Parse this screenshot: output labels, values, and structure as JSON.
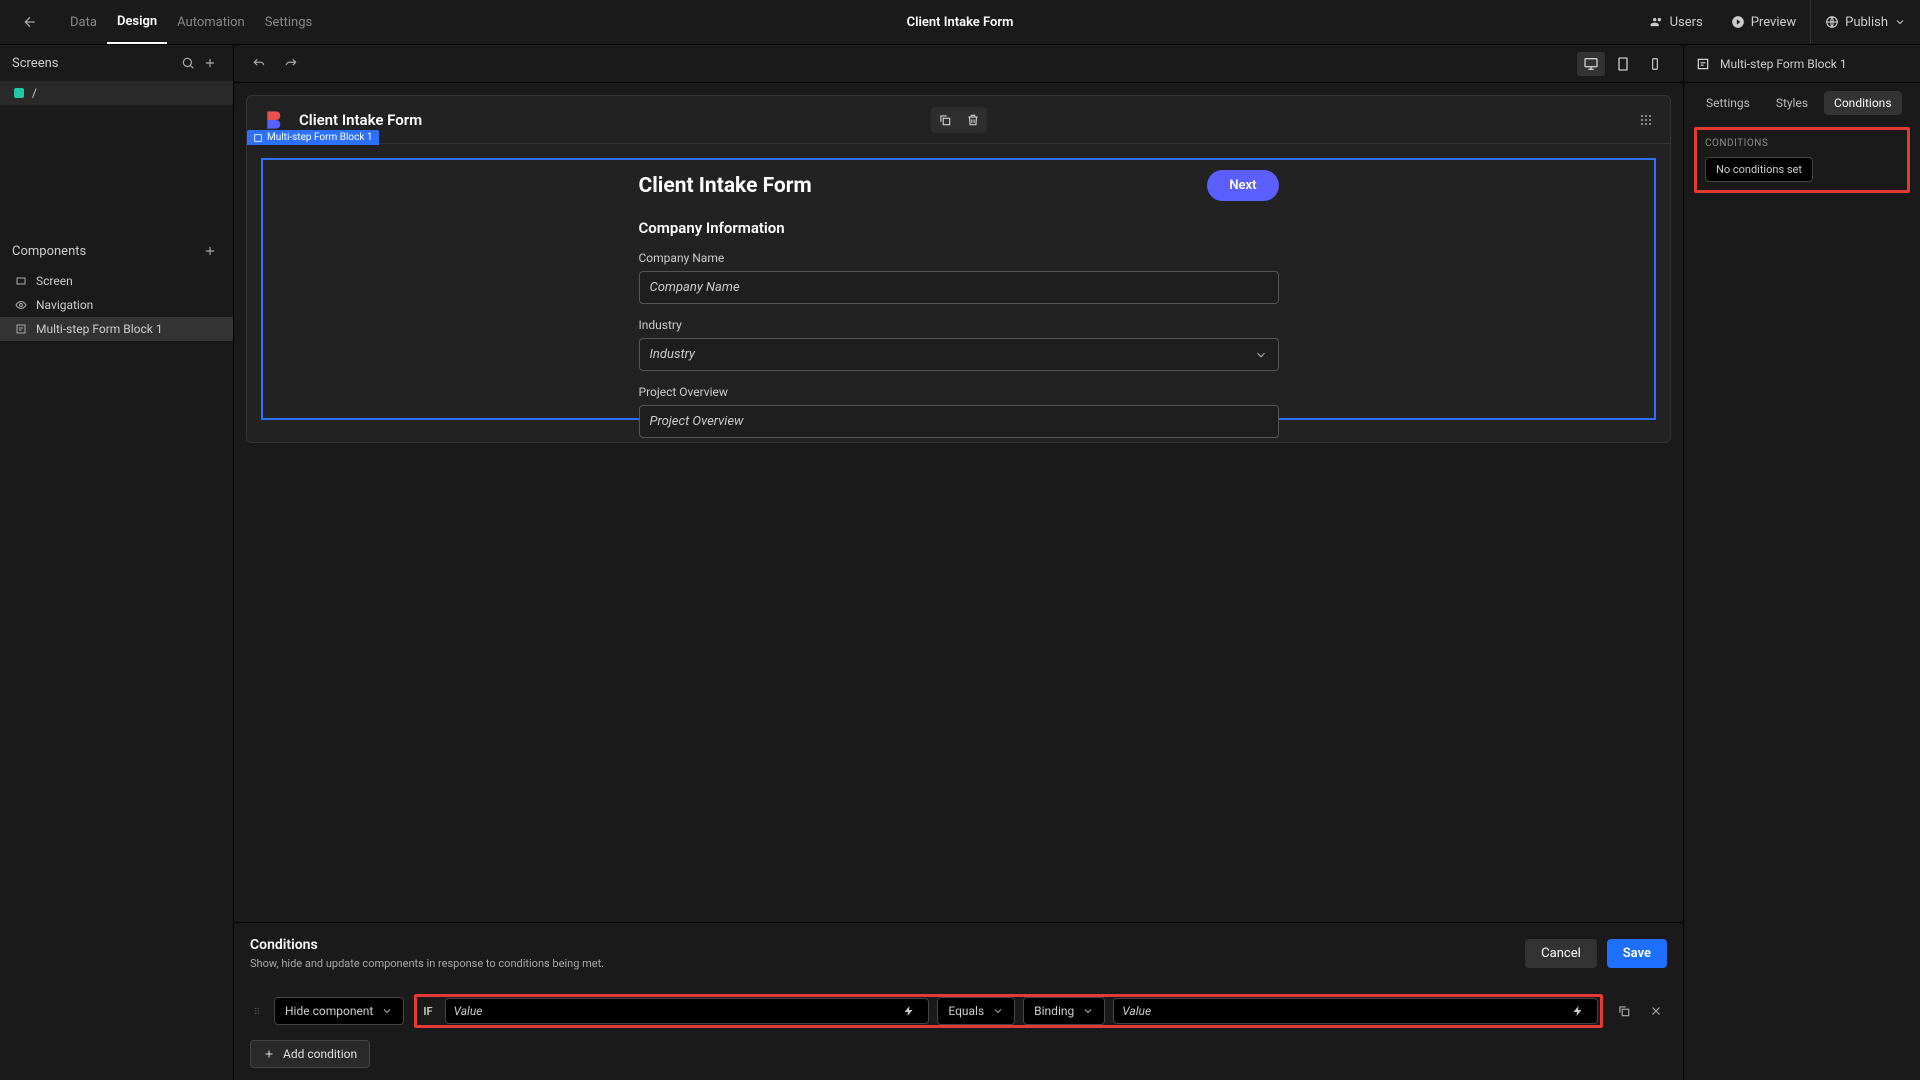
{
  "topbar": {
    "tabs": [
      "Data",
      "Design",
      "Automation",
      "Settings"
    ],
    "activeTab": 1,
    "title": "Client Intake Form",
    "users": "Users",
    "preview": "Preview",
    "publish": "Publish"
  },
  "leftPanel": {
    "screensLabel": "Screens",
    "screenItems": [
      "/"
    ],
    "componentsLabel": "Components",
    "componentItems": [
      {
        "label": "Screen",
        "icon": "rect"
      },
      {
        "label": "Navigation",
        "icon": "eye"
      },
      {
        "label": "Multi-step Form Block 1",
        "icon": "form",
        "selected": true
      }
    ]
  },
  "canvas": {
    "appTitle": "Client Intake Form",
    "blockTag": "Multi-step Form Block 1",
    "formTitle": "Client Intake Form",
    "nextLabel": "Next",
    "sectionTitle": "Company Information",
    "fields": [
      {
        "label": "Company Name",
        "placeholder": "Company Name",
        "type": "text"
      },
      {
        "label": "Industry",
        "placeholder": "Industry",
        "type": "select"
      },
      {
        "label": "Project Overview",
        "placeholder": "Project Overview",
        "type": "text"
      }
    ]
  },
  "bottomPanel": {
    "title": "Conditions",
    "subtitle": "Show, hide and update components in response to conditions being met.",
    "cancel": "Cancel",
    "save": "Save",
    "actionSelect": "Hide component",
    "if": "IF",
    "valuePlaceholder1": "Value",
    "operator": "Equals",
    "binding": "Binding",
    "valuePlaceholder2": "Value",
    "addCondition": "Add condition"
  },
  "rightPanel": {
    "selected": "Multi-step Form Block 1",
    "tabs": [
      "Settings",
      "Styles",
      "Conditions"
    ],
    "activeTab": 2,
    "conditionsLabel": "CONDITIONS",
    "noConditions": "No conditions set"
  }
}
